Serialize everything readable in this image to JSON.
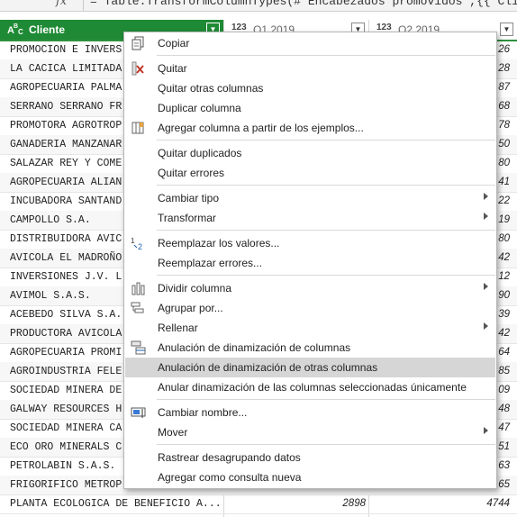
{
  "formula": {
    "fx_label": "fx",
    "text": "= Table.TransformColumnTypes(#\"Encabezados promovidos\",{{\"Cliente \", type"
  },
  "columns": [
    {
      "type_icon": "ABC",
      "name": "Cliente"
    },
    {
      "type_icon": "123",
      "name": "Q1 2019"
    },
    {
      "type_icon": "123",
      "name": "Q2 2019"
    }
  ],
  "rows": [
    {
      "name": "PROMOCION E INVERS",
      "q1": "",
      "q2": "26"
    },
    {
      "name": "LA CACICA LIMITADA",
      "q1": "",
      "q2": "28"
    },
    {
      "name": "AGROPECUARIA PALMA",
      "q1": "",
      "q2": "87"
    },
    {
      "name": "SERRANO SERRANO FR",
      "q1": "",
      "q2": "68"
    },
    {
      "name": "PROMOTORA AGROTROP",
      "q1": "",
      "q2": "78"
    },
    {
      "name": "GANADERIA MANZANAR",
      "q1": "",
      "q2": "50"
    },
    {
      "name": "SALAZAR REY Y COME",
      "q1": "",
      "q2": "80"
    },
    {
      "name": "AGROPECUARIA ALIAN",
      "q1": "",
      "q2": "41"
    },
    {
      "name": "INCUBADORA SANTAND",
      "q1": "",
      "q2": "22"
    },
    {
      "name": "CAMPOLLO S.A.",
      "q1": "",
      "q2": "19"
    },
    {
      "name": "DISTRIBUIDORA AVIC",
      "q1": "",
      "q2": "80"
    },
    {
      "name": "AVICOLA EL MADROÑO",
      "q1": "",
      "q2": "42"
    },
    {
      "name": "INVERSIONES J.V. L",
      "q1": "",
      "q2": "12"
    },
    {
      "name": "AVIMOL S.A.S.",
      "q1": "",
      "q2": "90"
    },
    {
      "name": "ACEBEDO SILVA S.A.",
      "q1": "",
      "q2": "39"
    },
    {
      "name": "PRODUCTORA AVICOLA",
      "q1": "",
      "q2": "42"
    },
    {
      "name": "AGROPECUARIA PROMI",
      "q1": "",
      "q2": "64"
    },
    {
      "name": "AGROINDUSTRIA FELE",
      "q1": "",
      "q2": "85"
    },
    {
      "name": "SOCIEDAD MINERA DE",
      "q1": "",
      "q2": "09"
    },
    {
      "name": "GALWAY RESOURCES H",
      "q1": "",
      "q2": "48"
    },
    {
      "name": "SOCIEDAD MINERA CA",
      "q1": "",
      "q2": "47"
    },
    {
      "name": "ECO ORO MINERALS C",
      "q1": "",
      "q2": "51"
    },
    {
      "name": "PETROLABIN S.A.S.",
      "q1": "",
      "q2": "63"
    },
    {
      "name": "FRIGORIFICO METROP",
      "q1": "",
      "q2": "65"
    },
    {
      "name": "PLANTA ECOLOGICA DE BENEFICIO A...",
      "q1": "2898",
      "q2": "4744"
    }
  ],
  "menu": {
    "items": [
      {
        "label": "Copiar",
        "icon": "copy-icon",
        "group": 1
      },
      {
        "label": "Quitar",
        "icon": "remove-column-icon",
        "group": 2
      },
      {
        "label": "Quitar otras columnas",
        "icon": "",
        "group": 2
      },
      {
        "label": "Duplicar columna",
        "icon": "",
        "group": 2
      },
      {
        "label": "Agregar columna a partir de los ejemplos...",
        "icon": "column-from-examples-icon",
        "group": 2
      },
      {
        "label": "Quitar duplicados",
        "icon": "",
        "group": 3
      },
      {
        "label": "Quitar errores",
        "icon": "",
        "group": 3
      },
      {
        "label": "Cambiar tipo",
        "icon": "",
        "group": 4,
        "submenu": true
      },
      {
        "label": "Transformar",
        "icon": "",
        "group": 4,
        "submenu": true
      },
      {
        "label": "Reemplazar los valores...",
        "icon": "replace-values-icon",
        "group": 5
      },
      {
        "label": "Reemplazar errores...",
        "icon": "",
        "group": 5
      },
      {
        "label": "Dividir columna",
        "icon": "split-column-icon",
        "group": 6,
        "submenu": true
      },
      {
        "label": "Agrupar por...",
        "icon": "group-by-icon",
        "group": 6
      },
      {
        "label": "Rellenar",
        "icon": "",
        "group": 6,
        "submenu": true
      },
      {
        "label": "Anulación de dinamización de columnas",
        "icon": "unpivot-icon",
        "group": 6
      },
      {
        "label": "Anulación de dinamización de otras columnas",
        "icon": "",
        "group": 6,
        "highlighted": true
      },
      {
        "label": "Anular dinamización de las columnas seleccionadas únicamente",
        "icon": "",
        "group": 6
      },
      {
        "label": "Cambiar nombre...",
        "icon": "rename-icon",
        "group": 7
      },
      {
        "label": "Mover",
        "icon": "",
        "group": 7,
        "submenu": true
      },
      {
        "label": "Rastrear desagrupando datos",
        "icon": "",
        "group": 8
      },
      {
        "label": "Agregar como consulta nueva",
        "icon": "",
        "group": 8
      }
    ]
  },
  "colors": {
    "header_active": "#1f8a35",
    "menu_highlight": "#d6d6d6",
    "remove_icon": "#c0392b"
  }
}
